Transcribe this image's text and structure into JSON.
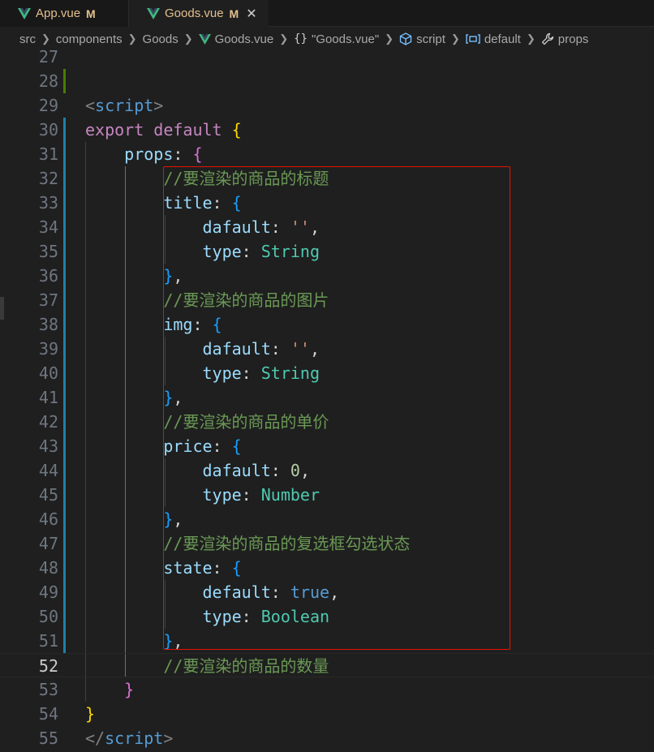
{
  "tabs": [
    {
      "name": "App.vue",
      "status": "M",
      "active": false
    },
    {
      "name": "Goods.vue",
      "status": "M",
      "active": true,
      "close": "✕"
    }
  ],
  "breadcrumb": {
    "items": [
      "src",
      "components",
      "Goods",
      "Goods.vue",
      "\"Goods.vue\"",
      "script",
      "default",
      "props"
    ],
    "icons": [
      "",
      "",
      "",
      "vue-icon",
      "braces-icon",
      "cube-icon",
      "module-icon",
      "wrench-icon"
    ]
  },
  "editor": {
    "current_line": 52,
    "lines": [
      {
        "n": "27",
        "tokens": []
      },
      {
        "n": "28",
        "tokens": []
      },
      {
        "n": "29",
        "tokens": [
          [
            "t-punc",
            "<"
          ],
          [
            "t-tag",
            "script"
          ],
          [
            "t-punc",
            ">"
          ]
        ]
      },
      {
        "n": "30",
        "tokens": [
          [
            "t-kw",
            "export"
          ],
          [
            "t-txt",
            " "
          ],
          [
            "t-kw",
            "default"
          ],
          [
            "t-txt",
            " "
          ],
          [
            "t-br",
            "{"
          ]
        ]
      },
      {
        "n": "31",
        "tokens": [
          [
            "t-txt",
            "    "
          ],
          [
            "t-prop",
            "props"
          ],
          [
            "t-txt",
            ": "
          ],
          [
            "t-br2",
            "{"
          ]
        ]
      },
      {
        "n": "32",
        "tokens": [
          [
            "t-txt",
            "        "
          ],
          [
            "t-cmt",
            "//要渲染的商品的标题"
          ]
        ]
      },
      {
        "n": "33",
        "tokens": [
          [
            "t-txt",
            "        "
          ],
          [
            "t-prop",
            "title"
          ],
          [
            "t-txt",
            ": "
          ],
          [
            "t-br3",
            "{"
          ]
        ]
      },
      {
        "n": "34",
        "tokens": [
          [
            "t-txt",
            "            "
          ],
          [
            "t-prop",
            "dafault"
          ],
          [
            "t-txt",
            ": "
          ],
          [
            "t-str",
            "''"
          ],
          [
            "t-txt",
            ","
          ]
        ]
      },
      {
        "n": "35",
        "tokens": [
          [
            "t-txt",
            "            "
          ],
          [
            "t-prop",
            "type"
          ],
          [
            "t-txt",
            ": "
          ],
          [
            "t-type",
            "String"
          ]
        ]
      },
      {
        "n": "36",
        "tokens": [
          [
            "t-txt",
            "        "
          ],
          [
            "t-br3",
            "}"
          ],
          [
            "t-txt",
            ","
          ]
        ]
      },
      {
        "n": "37",
        "tokens": [
          [
            "t-txt",
            "        "
          ],
          [
            "t-cmt",
            "//要渲染的商品的图片"
          ]
        ]
      },
      {
        "n": "38",
        "tokens": [
          [
            "t-txt",
            "        "
          ],
          [
            "t-prop",
            "img"
          ],
          [
            "t-txt",
            ": "
          ],
          [
            "t-br3",
            "{"
          ]
        ]
      },
      {
        "n": "39",
        "tokens": [
          [
            "t-txt",
            "            "
          ],
          [
            "t-prop",
            "dafault"
          ],
          [
            "t-txt",
            ": "
          ],
          [
            "t-str",
            "''"
          ],
          [
            "t-txt",
            ","
          ]
        ]
      },
      {
        "n": "40",
        "tokens": [
          [
            "t-txt",
            "            "
          ],
          [
            "t-prop",
            "type"
          ],
          [
            "t-txt",
            ": "
          ],
          [
            "t-type",
            "String"
          ]
        ]
      },
      {
        "n": "41",
        "tokens": [
          [
            "t-txt",
            "        "
          ],
          [
            "t-br3",
            "}"
          ],
          [
            "t-txt",
            ","
          ]
        ]
      },
      {
        "n": "42",
        "tokens": [
          [
            "t-txt",
            "        "
          ],
          [
            "t-cmt",
            "//要渲染的商品的单价"
          ]
        ]
      },
      {
        "n": "43",
        "tokens": [
          [
            "t-txt",
            "        "
          ],
          [
            "t-prop",
            "price"
          ],
          [
            "t-txt",
            ": "
          ],
          [
            "t-br3",
            "{"
          ]
        ]
      },
      {
        "n": "44",
        "tokens": [
          [
            "t-txt",
            "            "
          ],
          [
            "t-prop",
            "dafault"
          ],
          [
            "t-txt",
            ": "
          ],
          [
            "t-num",
            "0"
          ],
          [
            "t-txt",
            ","
          ]
        ]
      },
      {
        "n": "45",
        "tokens": [
          [
            "t-txt",
            "            "
          ],
          [
            "t-prop",
            "type"
          ],
          [
            "t-txt",
            ": "
          ],
          [
            "t-type",
            "Number"
          ]
        ]
      },
      {
        "n": "46",
        "tokens": [
          [
            "t-txt",
            "        "
          ],
          [
            "t-br3",
            "}"
          ],
          [
            "t-txt",
            ","
          ]
        ]
      },
      {
        "n": "47",
        "tokens": [
          [
            "t-txt",
            "        "
          ],
          [
            "t-cmt",
            "//要渲染的商品的复选框勾选状态"
          ]
        ]
      },
      {
        "n": "48",
        "tokens": [
          [
            "t-txt",
            "        "
          ],
          [
            "t-prop",
            "state"
          ],
          [
            "t-txt",
            ": "
          ],
          [
            "t-br3",
            "{"
          ]
        ]
      },
      {
        "n": "49",
        "tokens": [
          [
            "t-txt",
            "            "
          ],
          [
            "t-prop",
            "default"
          ],
          [
            "t-txt",
            ": "
          ],
          [
            "t-bool",
            "true"
          ],
          [
            "t-txt",
            ","
          ]
        ]
      },
      {
        "n": "50",
        "tokens": [
          [
            "t-txt",
            "            "
          ],
          [
            "t-prop",
            "type"
          ],
          [
            "t-txt",
            ": "
          ],
          [
            "t-type",
            "Boolean"
          ]
        ]
      },
      {
        "n": "51",
        "tokens": [
          [
            "t-txt",
            "        "
          ],
          [
            "t-br3",
            "}"
          ],
          [
            "t-txt",
            ","
          ]
        ]
      },
      {
        "n": "52",
        "tokens": [
          [
            "t-txt",
            "        "
          ],
          [
            "t-cmt",
            "//要渲染的商品的数量"
          ]
        ]
      },
      {
        "n": "53",
        "tokens": [
          [
            "t-txt",
            "    "
          ],
          [
            "t-br2",
            "}"
          ]
        ]
      },
      {
        "n": "54",
        "tokens": [
          [
            "t-br",
            "}"
          ]
        ]
      },
      {
        "n": "55",
        "tokens": [
          [
            "t-punc",
            "</"
          ],
          [
            "t-tag",
            "script"
          ],
          [
            "t-punc",
            ">"
          ]
        ]
      }
    ]
  },
  "colors": {
    "accent_modified": "#e2c08d",
    "selection_border": "#e51400",
    "vue_green": "#41b883"
  }
}
